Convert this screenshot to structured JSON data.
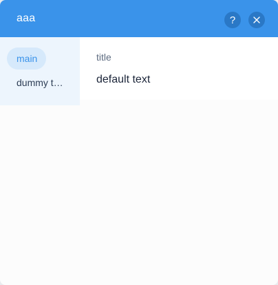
{
  "header": {
    "title": "aaa",
    "help_icon": "question-mark-icon",
    "help_glyph": "?",
    "close_icon": "close-icon"
  },
  "sidebar": {
    "items": [
      {
        "label": "main",
        "active": true
      },
      {
        "label": "dummy t…",
        "active": false
      }
    ]
  },
  "content": {
    "label": "title",
    "value": "default text"
  },
  "colors": {
    "accent": "#3a93ea",
    "header_button": "#2a78c6",
    "sidebar_bg": "#edf5fd",
    "active_item_bg": "#d6e9fb"
  }
}
